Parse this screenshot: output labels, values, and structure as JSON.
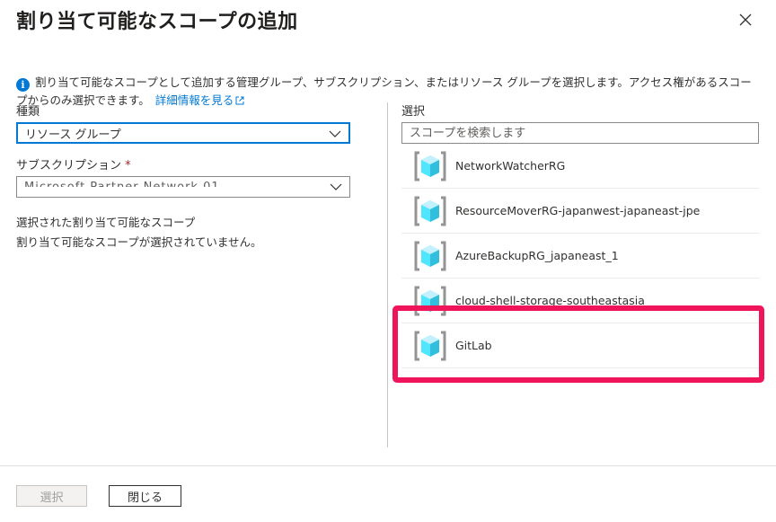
{
  "dialog": {
    "title": "割り当て可能なスコープの追加",
    "close_label": "×"
  },
  "info": {
    "text": "割り当て可能なスコープとして追加する管理グループ、サブスクリプション、またはリソース グループを選択します。アクセス権があるスコープからのみ選択できます。",
    "link": "詳細情報を見る"
  },
  "form": {
    "type_label": "種類",
    "type_value": "リソース グループ",
    "subscription_label": "サブスクリプション",
    "required_mark": "*",
    "subscription_value": "Microsoft Partner Network 01"
  },
  "selected": {
    "title": "選択された割り当て可能なスコープ",
    "empty": "割り当て可能なスコープが選択されていません。"
  },
  "right": {
    "label": "選択",
    "search_placeholder": "スコープを検索します",
    "items": [
      {
        "name": "NetworkWatcherRG",
        "icon": "resource-group-icon"
      },
      {
        "name": "ResourceMoverRG-japanwest-japaneast-jpe",
        "icon": "resource-group-icon"
      },
      {
        "name": "AzureBackupRG_japaneast_1",
        "icon": "resource-group-icon"
      },
      {
        "name": "cloud-shell-storage-southeastasia",
        "icon": "resource-group-icon"
      },
      {
        "name": "GitLab",
        "icon": "resource-group-icon"
      }
    ]
  },
  "footer": {
    "select_label": "選択",
    "close_label": "閉じる"
  },
  "colors": {
    "accent": "#0078d4",
    "highlight": "#f0145a",
    "required": "#a4262c"
  }
}
